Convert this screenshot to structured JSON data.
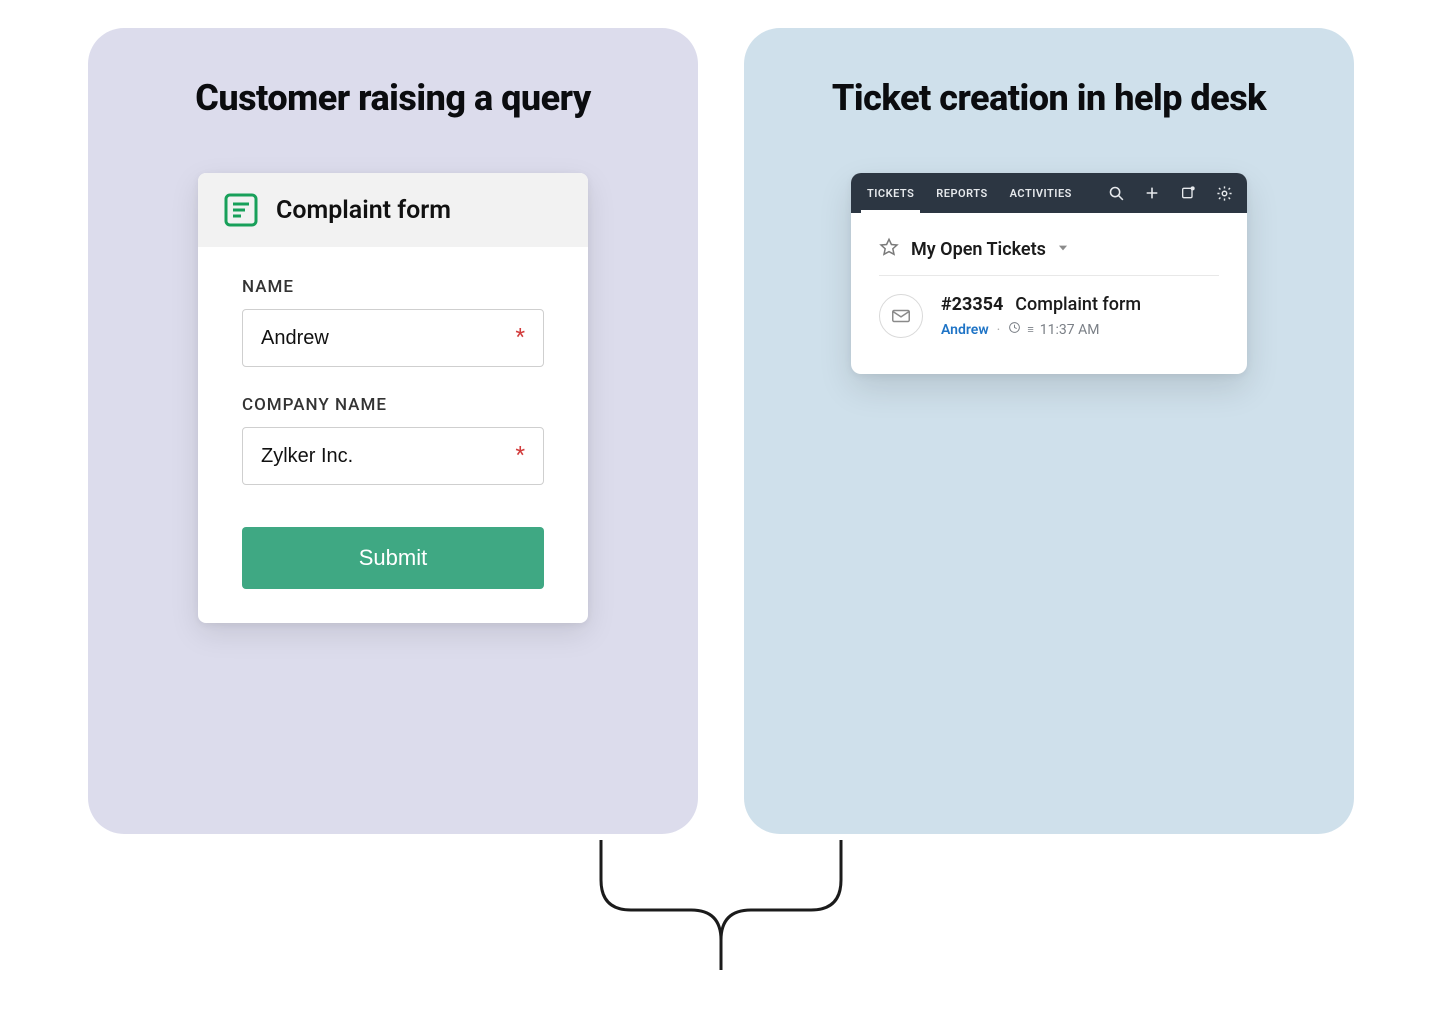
{
  "left_panel": {
    "title": "Customer raising a query",
    "form": {
      "title": "Complaint form",
      "name_label": "NAME",
      "name_value": "Andrew",
      "company_label": "COMPANY NAME",
      "company_value": "Zylker Inc.",
      "submit_label": "Submit"
    }
  },
  "right_panel": {
    "title": "Ticket creation in help desk",
    "desk": {
      "tabs": {
        "t0": "TICKETS",
        "t1": "REPORTS",
        "t2": "ACTIVITIES"
      },
      "filter_label": "My Open Tickets",
      "ticket": {
        "id": "#23354",
        "subject": "Complaint form",
        "author": "Andrew",
        "time": "11:37 AM"
      }
    }
  }
}
